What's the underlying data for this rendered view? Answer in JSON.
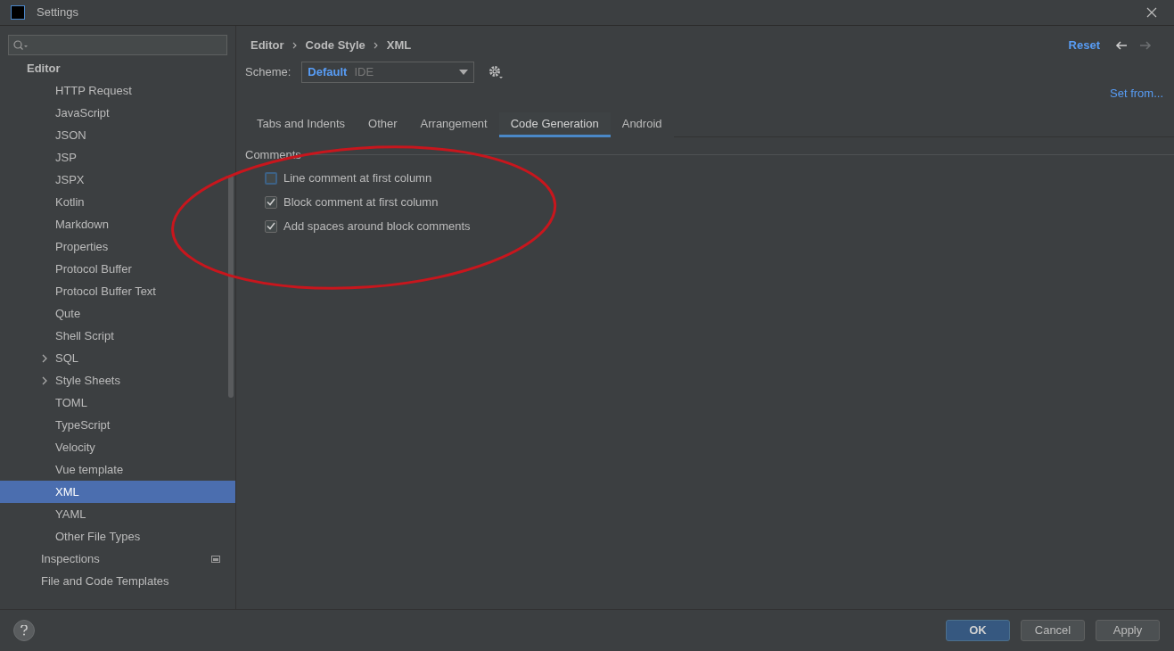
{
  "window": {
    "title": "Settings"
  },
  "sidebar": {
    "section": "Editor",
    "code_style_items": [
      {
        "label": "HTTP Request",
        "kind": "leaf",
        "selected": false
      },
      {
        "label": "JavaScript",
        "kind": "leaf",
        "selected": false
      },
      {
        "label": "JSON",
        "kind": "leaf",
        "selected": false
      },
      {
        "label": "JSP",
        "kind": "leaf",
        "selected": false
      },
      {
        "label": "JSPX",
        "kind": "leaf",
        "selected": false
      },
      {
        "label": "Kotlin",
        "kind": "leaf",
        "selected": false
      },
      {
        "label": "Markdown",
        "kind": "leaf",
        "selected": false
      },
      {
        "label": "Properties",
        "kind": "leaf",
        "selected": false
      },
      {
        "label": "Protocol Buffer",
        "kind": "leaf",
        "selected": false
      },
      {
        "label": "Protocol Buffer Text",
        "kind": "leaf",
        "selected": false
      },
      {
        "label": "Qute",
        "kind": "leaf",
        "selected": false
      },
      {
        "label": "Shell Script",
        "kind": "leaf",
        "selected": false
      },
      {
        "label": "SQL",
        "kind": "folder",
        "selected": false
      },
      {
        "label": "Style Sheets",
        "kind": "folder",
        "selected": false
      },
      {
        "label": "TOML",
        "kind": "leaf",
        "selected": false
      },
      {
        "label": "TypeScript",
        "kind": "leaf",
        "selected": false
      },
      {
        "label": "Velocity",
        "kind": "leaf",
        "selected": false
      },
      {
        "label": "Vue template",
        "kind": "leaf",
        "selected": false
      },
      {
        "label": "XML",
        "kind": "leaf",
        "selected": true
      },
      {
        "label": "YAML",
        "kind": "leaf",
        "selected": false
      },
      {
        "label": "Other File Types",
        "kind": "leaf",
        "selected": false
      }
    ],
    "editor_items": [
      {
        "label": "Inspections",
        "kind": "project",
        "selected": false
      },
      {
        "label": "File and Code Templates",
        "kind": "leaf",
        "selected": false
      }
    ]
  },
  "breadcrumb": [
    "Editor",
    "Code Style",
    "XML"
  ],
  "header_actions": {
    "reset": "Reset",
    "back_enabled": true,
    "forward_enabled": false
  },
  "scheme": {
    "label": "Scheme:",
    "name": "Default",
    "scope": "IDE"
  },
  "set_from": "Set from...",
  "tabs": [
    {
      "label": "Tabs and Indents",
      "selected": false
    },
    {
      "label": "Other",
      "selected": false
    },
    {
      "label": "Arrangement",
      "selected": false
    },
    {
      "label": "Code Generation",
      "selected": true
    },
    {
      "label": "Android",
      "selected": false
    }
  ],
  "comments": {
    "title": "Comments",
    "options": [
      {
        "label": "Line comment at first column",
        "checked": false
      },
      {
        "label": "Block comment at first column",
        "checked": true
      },
      {
        "label": "Add spaces around block comments",
        "checked": true
      }
    ]
  },
  "annotations": [
    {
      "kind": "ellipse",
      "color": "#c8161d"
    }
  ],
  "buttons": [
    {
      "label": "OK",
      "kind": "default"
    },
    {
      "label": "Cancel",
      "kind": "normal"
    },
    {
      "label": "Apply",
      "kind": "normal"
    }
  ]
}
